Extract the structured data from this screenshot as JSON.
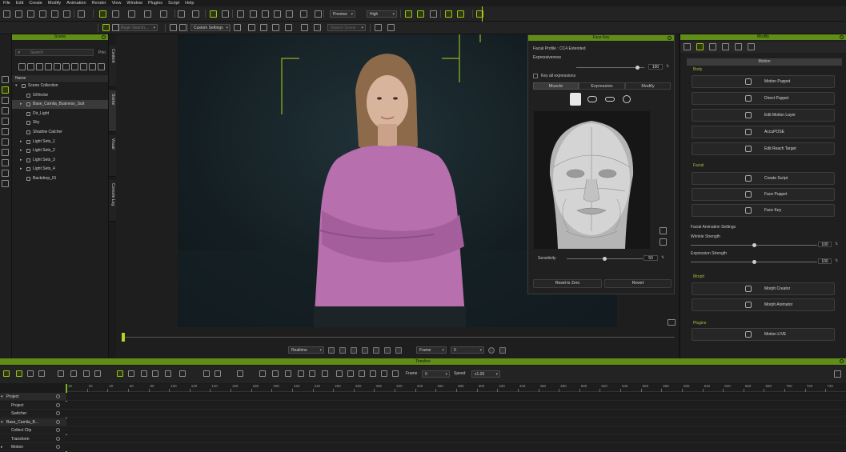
{
  "menu": [
    "File",
    "Edit",
    "Create",
    "Modify",
    "Animation",
    "Render",
    "View",
    "Window",
    "Plugins",
    "Script",
    "Help"
  ],
  "toolbar": {
    "preview_mode": "Preview",
    "quality": "High",
    "object_search_placeholder": "Begin Search...",
    "custom_settings": "Custom Settings",
    "search_scene_placeholder": "Search Scene"
  },
  "scene": {
    "title": "Scene",
    "search_placeholder": "Search",
    "search_suffix": "Prio",
    "column_header": "Name",
    "side_tabs": [
      "Content",
      "Scene",
      "Visual",
      "Console Log"
    ],
    "items": [
      {
        "label": "Scene Collection",
        "indent": 1,
        "expander": "▾"
      },
      {
        "label": "GiVector",
        "indent": 2,
        "expander": ""
      },
      {
        "label": "Base_Camila_Business_Suit",
        "indent": 2,
        "expander": "▸",
        "selected": true
      },
      {
        "label": "Dir_Light",
        "indent": 2,
        "expander": ""
      },
      {
        "label": "Sky",
        "indent": 2,
        "expander": ""
      },
      {
        "label": "Shadow Catcher",
        "indent": 2,
        "expander": ""
      },
      {
        "label": "Light Sets_1",
        "indent": 2,
        "expander": "▸"
      },
      {
        "label": "Light Sets_2",
        "indent": 2,
        "expander": "▸"
      },
      {
        "label": "Light Sets_3",
        "indent": 2,
        "expander": "▸"
      },
      {
        "label": "Light Sets_4",
        "indent": 2,
        "expander": "▸"
      },
      {
        "label": "Backdrop_01",
        "indent": 2,
        "expander": ""
      }
    ]
  },
  "viewport": {
    "playback_mode": "Realtime",
    "frame_mode": "Frame",
    "frame_value": "0"
  },
  "face_key": {
    "title": "Face Key",
    "profile": "Facial Profile : CC4 Extended",
    "expressiveness_label": "Expressiveness",
    "expressiveness_value": "100",
    "expressiveness_level": 0.9,
    "key_all_label": "Key all expressions",
    "tabs": [
      "Muscle",
      "Expression",
      "Modify"
    ],
    "sensitivity_label": "Sensitivity",
    "sensitivity_value": "50",
    "sensitivity_level": 0.5,
    "reset_label": "Reset to Zero",
    "revert_label": "Revert"
  },
  "modify": {
    "title": "Modify",
    "tab_label": "Motion",
    "body_section": "Body",
    "body_buttons": [
      "Motion Puppet",
      "Direct Puppet",
      "Edit Motion Layer",
      "AccuPOSE",
      "Edit Reach Target"
    ],
    "facial_section": "Facial",
    "facial_buttons": [
      "Create Script",
      "Face Puppet",
      "Face Key"
    ],
    "settings_section": "Facial Animation Settings",
    "wrinkle_label": "Wrinkle Strength",
    "wrinkle_value": "100",
    "wrinkle_level": 0.5,
    "expression_label": "Expression Strength",
    "expression_value": "100",
    "expression_level": 0.5,
    "morph_section": "Morph",
    "morph_buttons": [
      "Morph Creator",
      "Morph Animator"
    ],
    "plugins_section": "Plugins",
    "plugin_buttons": [
      "Motion LIVE"
    ]
  },
  "timeline": {
    "title": "Timeline",
    "frame_label": "Frame",
    "frame_value": "0",
    "speed_label": "Speed",
    "speed_value": "x1.00",
    "ticks": [
      "10",
      "20",
      "40",
      "60",
      "80",
      "100",
      "120",
      "140",
      "160",
      "180",
      "200",
      "220",
      "240",
      "260",
      "280",
      "300",
      "320",
      "340",
      "360",
      "380",
      "400",
      "420",
      "440",
      "460",
      "480",
      "500",
      "520",
      "540",
      "560",
      "580",
      "600",
      "620",
      "640",
      "660",
      "680",
      "700",
      "720",
      "740"
    ],
    "rows": [
      {
        "label": "Project",
        "level": 0,
        "expander": "▾",
        "header": true
      },
      {
        "label": "Project",
        "level": 1,
        "expander": ""
      },
      {
        "label": "Switcher",
        "level": 1,
        "expander": ""
      },
      {
        "label": "Base_Camila_B...",
        "level": 0,
        "expander": "▾",
        "header": true
      },
      {
        "label": "Collect Clip",
        "level": 1,
        "expander": ""
      },
      {
        "label": "Transform",
        "level": 1,
        "expander": ""
      },
      {
        "label": "Motion",
        "level": 1,
        "expander": "▸"
      }
    ]
  },
  "colors": {
    "accent": "#7cb518",
    "panel_header": "#5f8d17"
  }
}
